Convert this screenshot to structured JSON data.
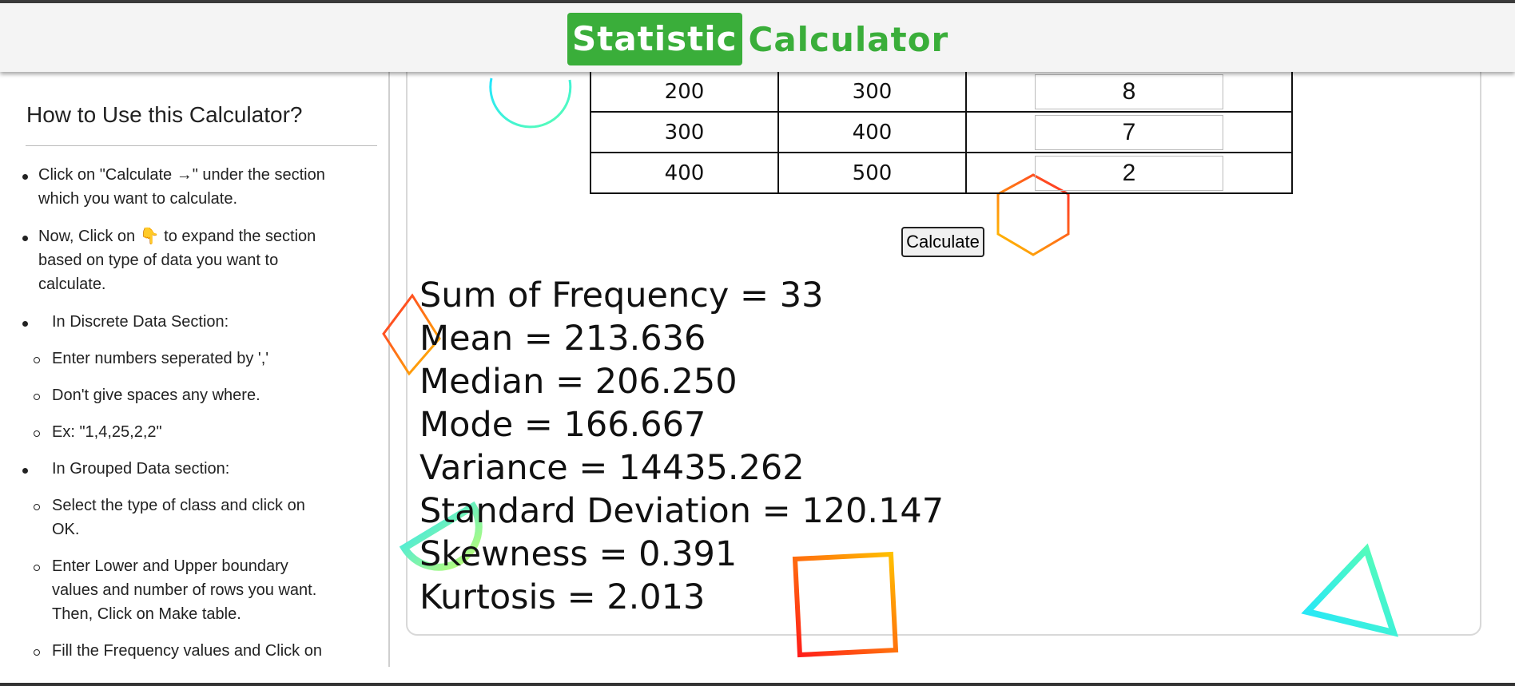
{
  "header": {
    "logo_box": "Statistic",
    "logo_rest": "Calculator"
  },
  "sidebar": {
    "title": "How to Use this Calculator?",
    "items": [
      {
        "kind": "bullet",
        "lines": [
          "Click on \"Calculate →\" under the section",
          "which you want to calculate."
        ]
      },
      {
        "kind": "bullet",
        "lines": [
          "Now, Click on 👇  to expand the section",
          "based on type of data you want to",
          "calculate."
        ]
      },
      {
        "kind": "bullet",
        "lines": [
          "In Discrete Data Section:"
        ]
      },
      {
        "kind": "sub",
        "lines": [
          "Enter numbers seperated by ','"
        ]
      },
      {
        "kind": "sub",
        "lines": [
          "Don't give spaces any where."
        ]
      },
      {
        "kind": "sub",
        "lines": [
          "Ex: \"1,4,25,2,2\""
        ]
      },
      {
        "kind": "bullet",
        "lines": [
          "In Grouped Data section:"
        ]
      },
      {
        "kind": "sub",
        "lines": [
          "Select the type of class and click on",
          "OK."
        ]
      },
      {
        "kind": "sub",
        "lines": [
          "Enter Lower and Upper boundary",
          "values and number of rows you want.",
          "Then, Click on Make table."
        ]
      },
      {
        "kind": "sub",
        "lines": [
          "Fill the Frequency values and Click on"
        ]
      }
    ]
  },
  "table": {
    "rows": [
      {
        "lower": "200",
        "upper": "300",
        "freq": "8"
      },
      {
        "lower": "300",
        "upper": "400",
        "freq": "7"
      },
      {
        "lower": "400",
        "upper": "500",
        "freq": "2"
      }
    ]
  },
  "calculate_label": "Calculate",
  "results": [
    "Sum of Frequency = 33",
    "Mean = 213.636",
    "Median = 206.250",
    "Mode = 166.667",
    "Variance = 14435.262",
    "Standard Deviation = 120.147",
    "Skewness = 0.391",
    "Kurtosis = 2.013"
  ],
  "colors": {
    "brand_green": "#3aae3a"
  }
}
